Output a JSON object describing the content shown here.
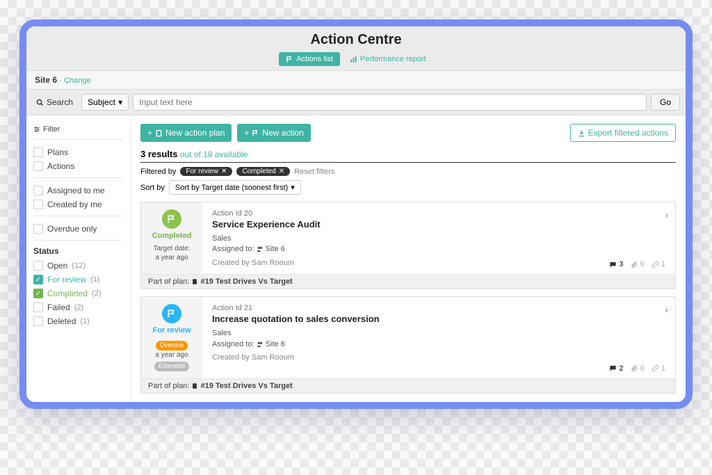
{
  "header": {
    "title": "Action Centre",
    "tabs": {
      "list": "Actions list",
      "perf": "Performance report"
    }
  },
  "site": {
    "name": "Site 6",
    "change": "· Change"
  },
  "search": {
    "label": "Search",
    "subject": "Subject",
    "placeholder": "Input text here",
    "go": "Go"
  },
  "sidebar": {
    "filter": "Filter",
    "plans": "Plans",
    "actions": "Actions",
    "assigned": "Assigned to me",
    "created": "Created by me",
    "overdue": "Overdue only",
    "status": "Status",
    "statuses": {
      "open": {
        "label": "Open",
        "count": "(12)"
      },
      "review": {
        "label": "For review",
        "count": "(1)"
      },
      "completed": {
        "label": "Completed",
        "count": "(2)"
      },
      "failed": {
        "label": "Failed",
        "count": "(2)"
      },
      "deleted": {
        "label": "Deleted",
        "count": "(1)"
      }
    }
  },
  "content": {
    "new_plan": "New action plan",
    "new_action": "New action",
    "export": "Export filtered actions",
    "results_count": "3 results",
    "available": "out of 18 available",
    "filtered_by": "Filtered by",
    "chips": {
      "review": "For review",
      "completed": "Completed"
    },
    "reset": "Reset filters",
    "sort_label": "Sort by",
    "sort_value": "Sort by Target date (soonest first)"
  },
  "cards": [
    {
      "status": "Completed",
      "target_label": "Target date:",
      "target_value": "a year ago",
      "id": "Action Id 20",
      "title": "Service Experience Audit",
      "category": "Sales",
      "assigned_label": "Assigned to:",
      "assigned_value": "Site 6",
      "created": "Created by Sam Rooum",
      "comments": "3",
      "attach": "0",
      "links": "1",
      "plan": "Part of plan:",
      "plan_name": "#19 Test Drives Vs Target"
    },
    {
      "status": "For review",
      "overdue": "Overdue",
      "target_value": "a year ago",
      "extended": "Extended",
      "id": "Action Id 21",
      "title": "Increase quotation to sales conversion",
      "category": "Sales",
      "assigned_label": "Assigned to:",
      "assigned_value": "Site 6",
      "created": "Created by Sam Rooum",
      "comments": "2",
      "attach": "0",
      "links": "1",
      "plan": "Part of plan:",
      "plan_name": "#19 Test Drives Vs Target"
    }
  ]
}
